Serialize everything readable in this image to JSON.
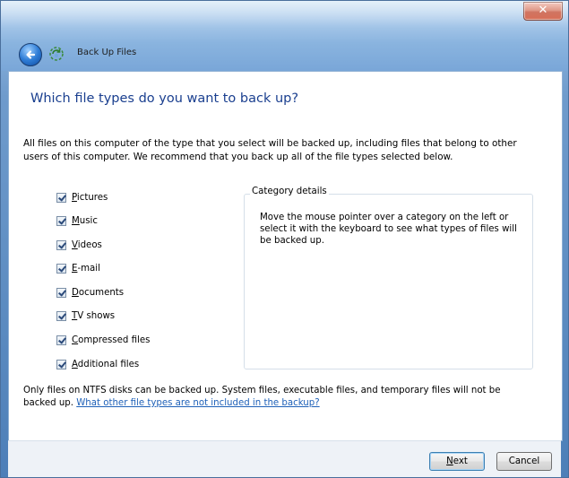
{
  "window": {
    "title": "Back Up Files",
    "close_glyph": "✕"
  },
  "heading": "Which file types do you want to back up?",
  "description": "All files on this computer of the type that you select will be backed up, including files that belong to other users of this computer. We recommend that you back up all of the file types selected below.",
  "categories": [
    {
      "label_accel": "P",
      "label_rest": "ictures",
      "checked": true
    },
    {
      "label_accel": "M",
      "label_rest": "usic",
      "checked": true
    },
    {
      "label_accel": "V",
      "label_rest": "ideos",
      "checked": true
    },
    {
      "label_accel": "E",
      "label_rest": "-mail",
      "checked": true
    },
    {
      "label_accel": "D",
      "label_rest": "ocuments",
      "checked": true
    },
    {
      "label_accel": "T",
      "label_rest": "V shows",
      "checked": true
    },
    {
      "label_accel": "C",
      "label_rest": "ompressed files",
      "checked": true
    },
    {
      "label_accel": "A",
      "label_rest": "dditional files",
      "checked": true
    }
  ],
  "details": {
    "title": "Category details",
    "text": "Move the mouse pointer over a category on the left or select it with the keyboard to see what types of files will be backed up."
  },
  "footnote": {
    "text": "Only files on NTFS disks can be backed up. System files, executable files, and temporary files will not be backed up. ",
    "link": "What other file types are not included in the backup?"
  },
  "buttons": {
    "next_accel": "N",
    "next_rest": "ext",
    "cancel": "Cancel"
  },
  "icons": [
    "back-arrow-icon",
    "backup-app-icon",
    "close-icon",
    "checkbox-checked-icon"
  ]
}
